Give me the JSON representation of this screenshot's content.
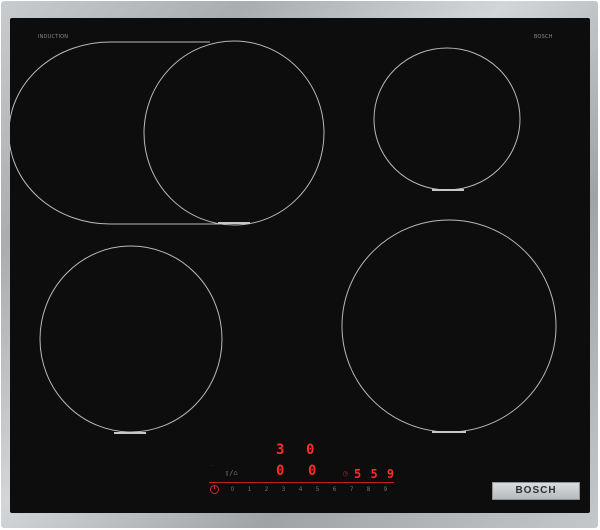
{
  "brand": "BOSCH",
  "labels": {
    "top_left": "INDUCTION",
    "top_right": "BOSCH"
  },
  "controls": {
    "display_top": [
      "3",
      "0"
    ],
    "display_bottom": [
      "0",
      "0"
    ],
    "timer_display": "5 5 9",
    "power_scale": [
      "0",
      "1",
      "2",
      "3",
      "4",
      "5",
      "6",
      "7",
      "8",
      "9"
    ]
  },
  "colors": {
    "glass": "#0d0d0e",
    "zone_line": "#b9b9b9",
    "display_red": "#ff2a2a",
    "frame_steel": "#b5b9bc"
  },
  "icons": [
    "power-icon",
    "timer-icon"
  ]
}
